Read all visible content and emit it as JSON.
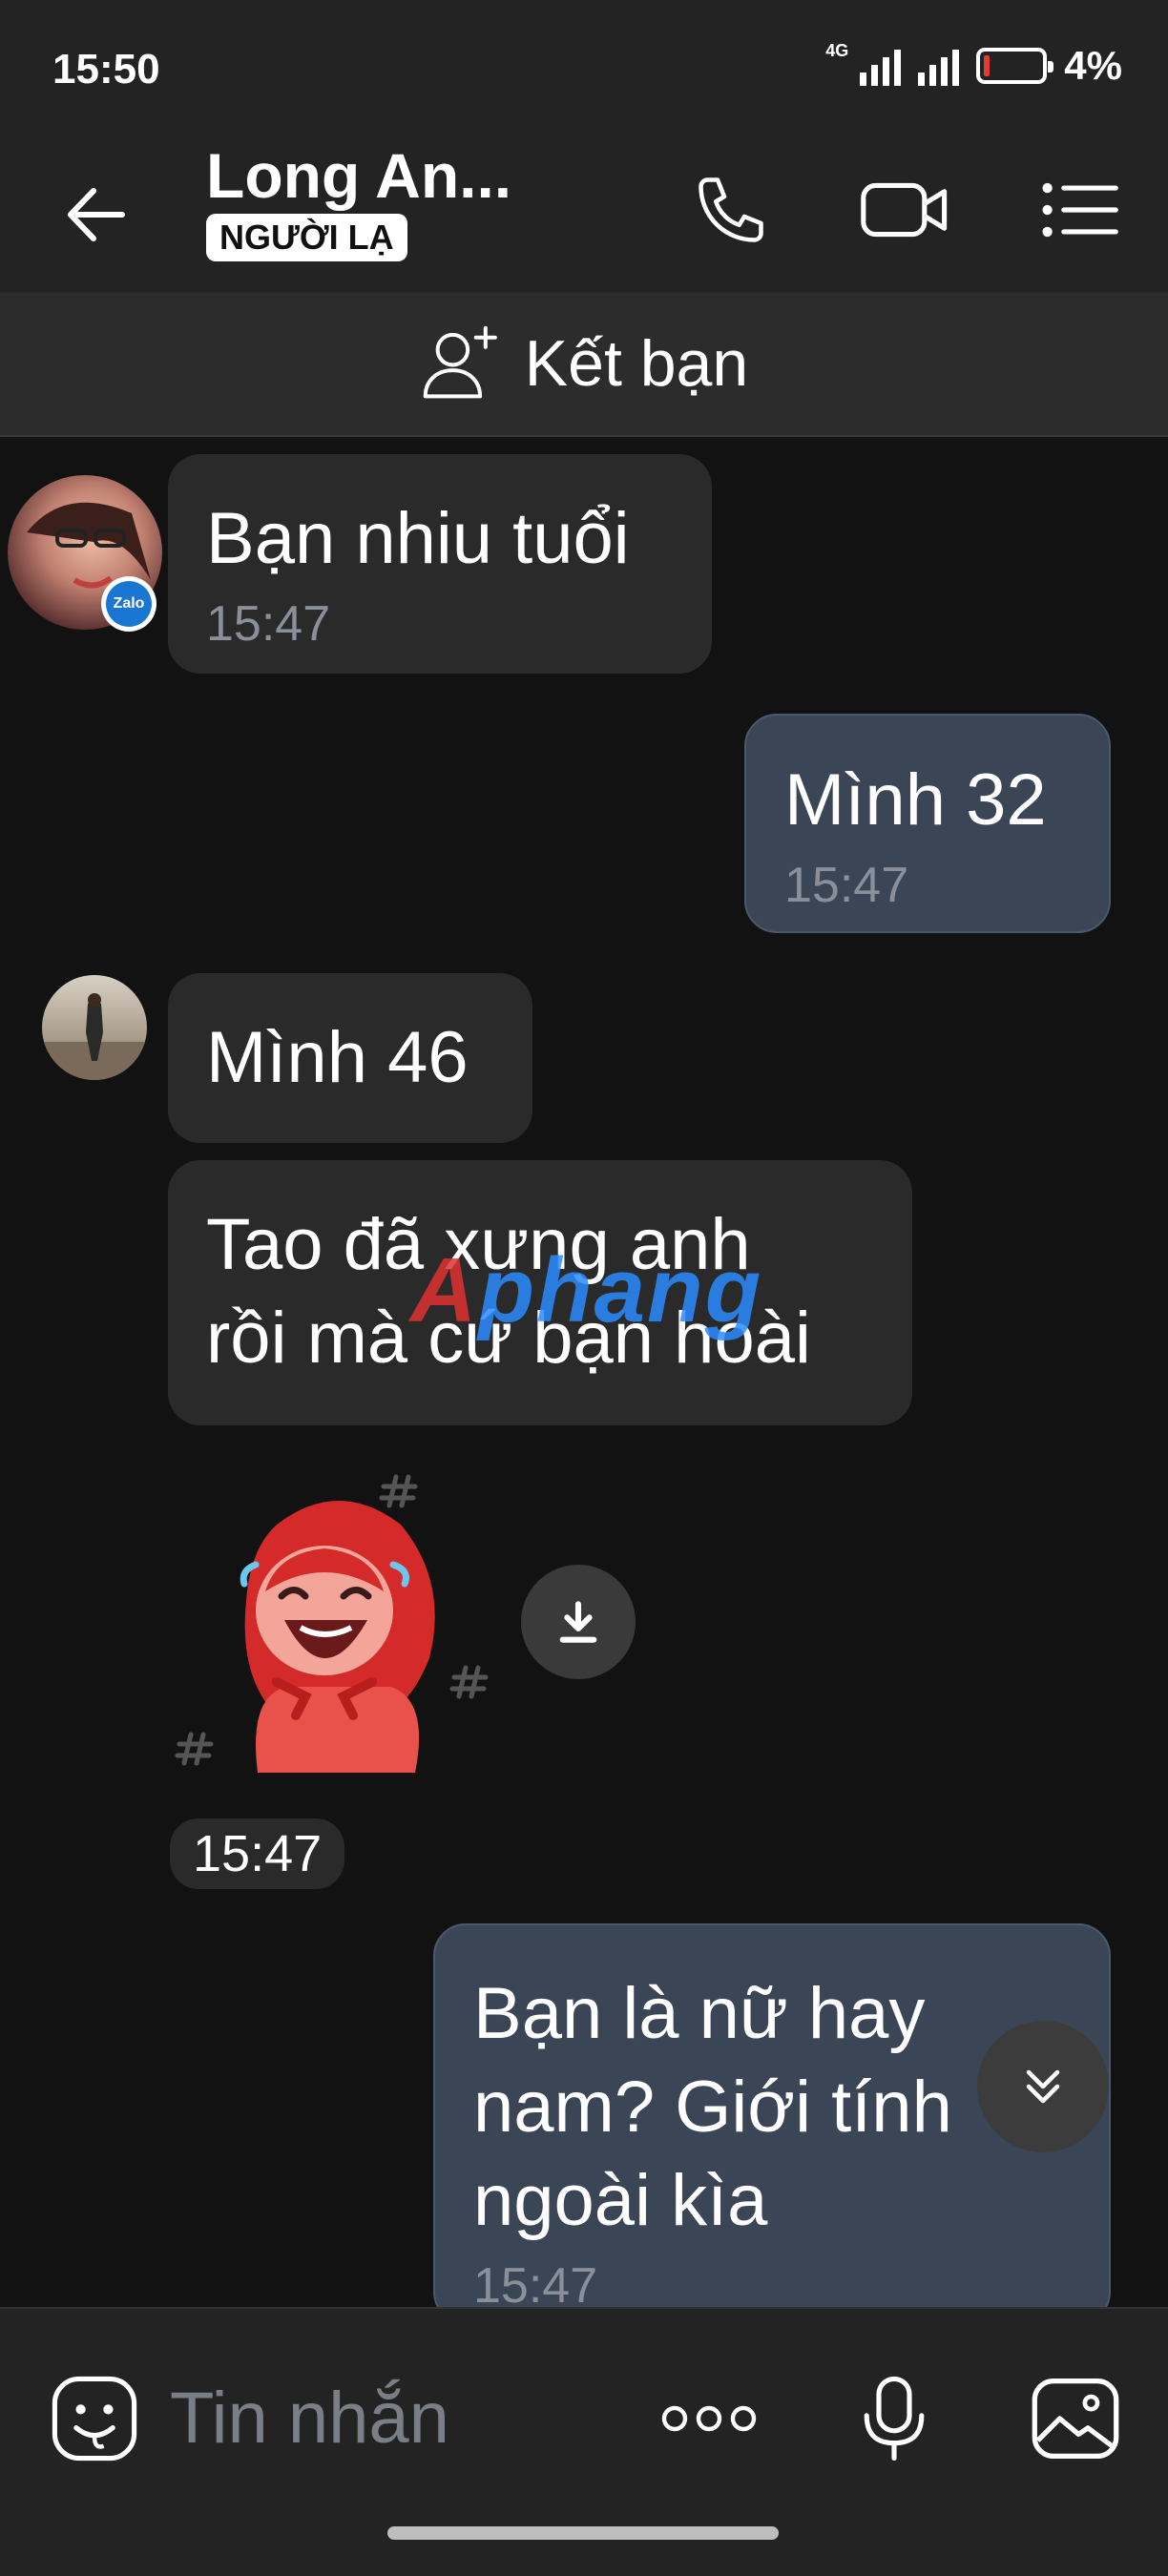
{
  "status": {
    "time": "15:50",
    "network": "4G",
    "battery_pct": "4%",
    "battery_level": 0.04
  },
  "header": {
    "title": "Long An...",
    "badge": "NGƯỜI LẠ"
  },
  "friend_bar": {
    "label": "Kết bạn"
  },
  "messages": [
    {
      "dir": "in",
      "text": "Bạn nhiu tuổi",
      "time": "15:47"
    },
    {
      "dir": "out",
      "text": "Mình 32",
      "time": "15:47"
    },
    {
      "dir": "in",
      "text": "Mình 46"
    },
    {
      "dir": "in",
      "lines": [
        "Tao đã xưng anh",
        "rồi mà cứ bạn hoài"
      ]
    },
    {
      "dir": "in",
      "type": "sticker",
      "time": "15:47"
    },
    {
      "dir": "out",
      "lines": [
        "Bạn là nữ hay",
        "nam? Giới tính",
        "ngoài kìa"
      ],
      "time": "15:47"
    }
  ],
  "avatar_badge": "Zalo",
  "watermark": {
    "part1": "A",
    "part2": "phang"
  },
  "input": {
    "placeholder": "Tin nhắn"
  },
  "colors": {
    "background": "#121212",
    "bar": "#232323",
    "in_bubble": "#2a2a2a",
    "out_bubble": "#3a4555"
  }
}
